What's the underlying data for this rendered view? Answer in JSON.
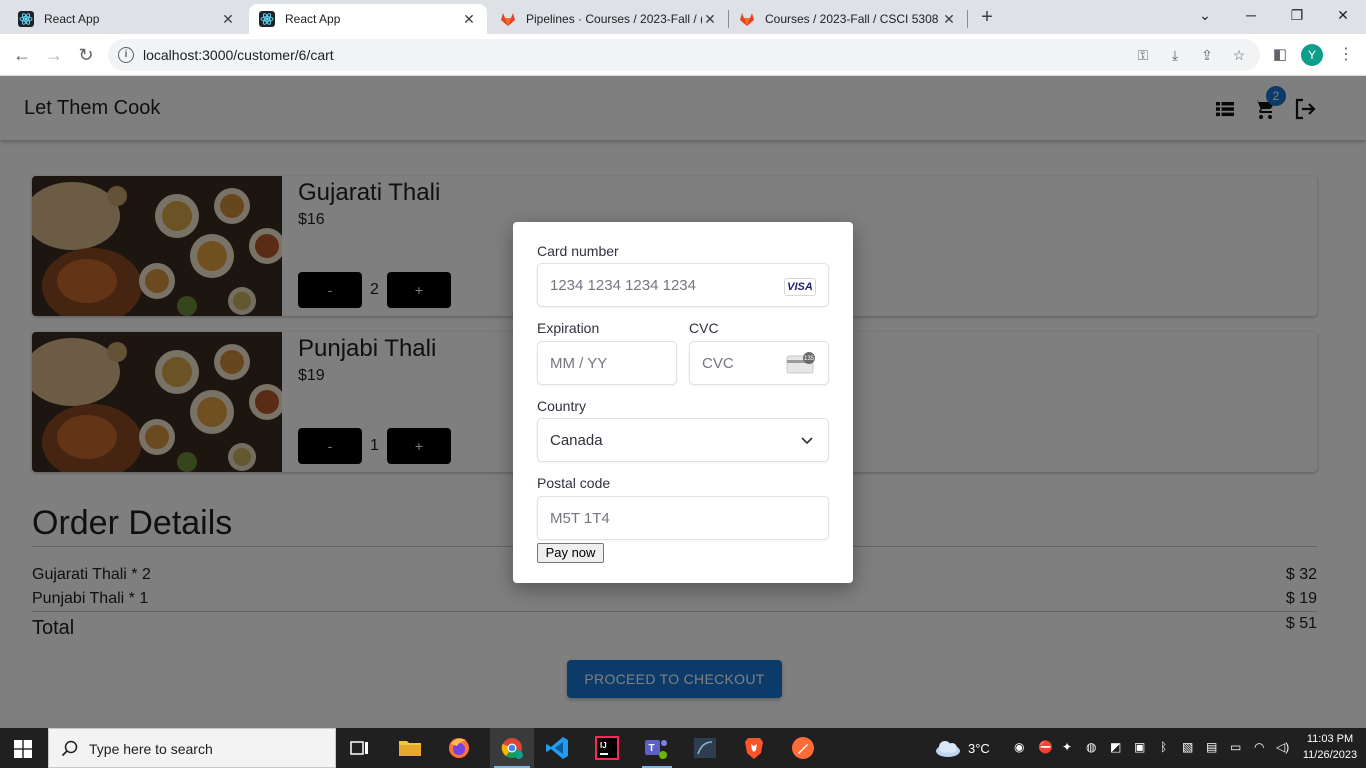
{
  "browser": {
    "tabs": [
      {
        "title": "React App",
        "active": false
      },
      {
        "title": "React App",
        "active": true
      },
      {
        "title": "Pipelines · Courses / 2023-Fall / (",
        "active": false
      },
      {
        "title": "Courses / 2023-Fall / CSCI 5308",
        "active": false
      }
    ],
    "url": "localhost:3000/customer/6/cart",
    "profile_initial": "Y"
  },
  "app": {
    "brand": "Let Them Cook",
    "cart_count": "2",
    "items": [
      {
        "name": "Gujarati Thali",
        "price": "$16",
        "quantity": "2",
        "decrement": "-",
        "increment": "+"
      },
      {
        "name": "Punjabi Thali",
        "price": "$19",
        "quantity": "1",
        "decrement": "-",
        "increment": "+"
      }
    ],
    "order": {
      "title": "Order Details",
      "lines": [
        {
          "label": "Gujarati Thali * 2",
          "amount": "$ 32"
        },
        {
          "label": "Punjabi Thali * 1",
          "amount": "$ 19"
        }
      ],
      "total_label": "Total",
      "total_amount": "$ 51"
    },
    "checkout_label": "PROCEED TO CHECKOUT"
  },
  "payment": {
    "card_number_label": "Card number",
    "card_number_placeholder": "1234 1234 1234 1234",
    "card_brand": "VISA",
    "expiration_label": "Expiration",
    "expiration_placeholder": "MM / YY",
    "cvc_label": "CVC",
    "cvc_placeholder": "CVC",
    "cvc_icon_text": "135",
    "country_label": "Country",
    "country_value": "Canada",
    "postal_label": "Postal code",
    "postal_placeholder": "M5T 1T4",
    "pay_label": "Pay now"
  },
  "taskbar": {
    "search_placeholder": "Type here to search",
    "weather": "3°C",
    "time": "11:03 PM",
    "date": "11/26/2023"
  },
  "colors": {
    "primary": "#1976d2",
    "qty_button": "#000000",
    "taskbar": "#202020"
  }
}
